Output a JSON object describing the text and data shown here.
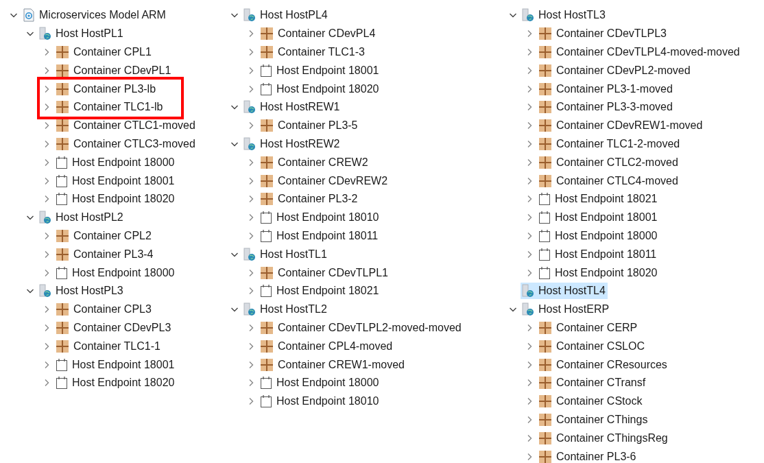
{
  "tree": {
    "kind": "root",
    "label": "Microservices Model ARM",
    "expanded": true,
    "selected": false,
    "children": [
      {
        "kind": "host",
        "label": "Host HostPL1",
        "expanded": true,
        "selected": false,
        "children": [
          {
            "kind": "container",
            "label": "Container CPL1",
            "expanded": false,
            "selected": false,
            "highlighted": false
          },
          {
            "kind": "container",
            "label": "Container CDevPL1",
            "expanded": false,
            "selected": false,
            "highlighted": false
          },
          {
            "kind": "container",
            "label": "Container PL3-lb",
            "expanded": false,
            "selected": false,
            "highlighted": true
          },
          {
            "kind": "container",
            "label": "Container TLC1-lb",
            "expanded": false,
            "selected": false,
            "highlighted": true
          },
          {
            "kind": "container",
            "label": "Container CTLC1-moved",
            "expanded": false,
            "selected": false,
            "highlighted": false
          },
          {
            "kind": "container",
            "label": "Container CTLC3-moved",
            "expanded": false,
            "selected": false,
            "highlighted": false
          },
          {
            "kind": "endpoint",
            "label": "Host Endpoint 18000",
            "expanded": false,
            "selected": false,
            "highlighted": false
          },
          {
            "kind": "endpoint",
            "label": "Host Endpoint 18001",
            "expanded": false,
            "selected": false,
            "highlighted": false
          },
          {
            "kind": "endpoint",
            "label": "Host Endpoint 18020",
            "expanded": false,
            "selected": false,
            "highlighted": false
          }
        ]
      },
      {
        "kind": "host",
        "label": "Host HostPL2",
        "expanded": true,
        "selected": false,
        "children": [
          {
            "kind": "container",
            "label": "Container CPL2",
            "expanded": false,
            "selected": false,
            "highlighted": false
          },
          {
            "kind": "container",
            "label": "Container PL3-4",
            "expanded": false,
            "selected": false,
            "highlighted": false
          },
          {
            "kind": "endpoint",
            "label": "Host Endpoint 18000",
            "expanded": false,
            "selected": false,
            "highlighted": false
          }
        ]
      },
      {
        "kind": "host",
        "label": "Host HostPL3",
        "expanded": true,
        "selected": false,
        "children": [
          {
            "kind": "container",
            "label": "Container CPL3",
            "expanded": false,
            "selected": false,
            "highlighted": false
          },
          {
            "kind": "container",
            "label": "Container CDevPL3",
            "expanded": false,
            "selected": false,
            "highlighted": false
          },
          {
            "kind": "container",
            "label": "Container TLC1-1",
            "expanded": false,
            "selected": false,
            "highlighted": false
          },
          {
            "kind": "endpoint",
            "label": "Host Endpoint 18001",
            "expanded": false,
            "selected": false,
            "highlighted": false
          },
          {
            "kind": "endpoint",
            "label": "Host Endpoint 18020",
            "expanded": false,
            "selected": false,
            "highlighted": false
          }
        ]
      },
      {
        "kind": "host",
        "label": "Host HostPL4",
        "expanded": true,
        "selected": false,
        "children": [
          {
            "kind": "container",
            "label": "Container CDevPL4",
            "expanded": false,
            "selected": false,
            "highlighted": false
          },
          {
            "kind": "container",
            "label": "Container TLC1-3",
            "expanded": false,
            "selected": false,
            "highlighted": false
          },
          {
            "kind": "endpoint",
            "label": "Host Endpoint 18001",
            "expanded": false,
            "selected": false,
            "highlighted": false
          },
          {
            "kind": "endpoint",
            "label": "Host Endpoint 18020",
            "expanded": false,
            "selected": false,
            "highlighted": false
          }
        ]
      },
      {
        "kind": "host",
        "label": "Host HostREW1",
        "expanded": true,
        "selected": false,
        "children": [
          {
            "kind": "container",
            "label": "Container PL3-5",
            "expanded": false,
            "selected": false,
            "highlighted": false
          }
        ]
      },
      {
        "kind": "host",
        "label": "Host HostREW2",
        "expanded": true,
        "selected": false,
        "children": [
          {
            "kind": "container",
            "label": "Container CREW2",
            "expanded": false,
            "selected": false,
            "highlighted": false
          },
          {
            "kind": "container",
            "label": "Container CDevREW2",
            "expanded": false,
            "selected": false,
            "highlighted": false
          },
          {
            "kind": "container",
            "label": "Container PL3-2",
            "expanded": false,
            "selected": false,
            "highlighted": false
          },
          {
            "kind": "endpoint",
            "label": "Host Endpoint 18010",
            "expanded": false,
            "selected": false,
            "highlighted": false
          },
          {
            "kind": "endpoint",
            "label": "Host Endpoint 18011",
            "expanded": false,
            "selected": false,
            "highlighted": false
          }
        ]
      },
      {
        "kind": "host",
        "label": "Host HostTL1",
        "expanded": true,
        "selected": false,
        "children": [
          {
            "kind": "container",
            "label": "Container CDevTLPL1",
            "expanded": false,
            "selected": false,
            "highlighted": false
          },
          {
            "kind": "endpoint",
            "label": "Host Endpoint 18021",
            "expanded": false,
            "selected": false,
            "highlighted": false
          }
        ]
      },
      {
        "kind": "host",
        "label": "Host HostTL2",
        "expanded": true,
        "selected": false,
        "children": [
          {
            "kind": "container",
            "label": "Container CDevTLPL2-moved-moved",
            "expanded": false,
            "selected": false,
            "highlighted": false
          },
          {
            "kind": "container",
            "label": "Container CPL4-moved",
            "expanded": false,
            "selected": false,
            "highlighted": false
          },
          {
            "kind": "container",
            "label": "Container CREW1-moved",
            "expanded": false,
            "selected": false,
            "highlighted": false
          },
          {
            "kind": "endpoint",
            "label": "Host Endpoint 18000",
            "expanded": false,
            "selected": false,
            "highlighted": false
          },
          {
            "kind": "endpoint",
            "label": "Host Endpoint 18010",
            "expanded": false,
            "selected": false,
            "highlighted": false
          }
        ]
      },
      {
        "kind": "host",
        "label": "Host HostTL3",
        "expanded": true,
        "selected": false,
        "children": [
          {
            "kind": "container",
            "label": "Container CDevTLPL3",
            "expanded": false,
            "selected": false,
            "highlighted": false
          },
          {
            "kind": "container",
            "label": "Container CDevTLPL4-moved-moved",
            "expanded": false,
            "selected": false,
            "highlighted": false
          },
          {
            "kind": "container",
            "label": "Container CDevPL2-moved",
            "expanded": false,
            "selected": false,
            "highlighted": false
          },
          {
            "kind": "container",
            "label": "Container PL3-1-moved",
            "expanded": false,
            "selected": false,
            "highlighted": false
          },
          {
            "kind": "container",
            "label": "Container PL3-3-moved",
            "expanded": false,
            "selected": false,
            "highlighted": false
          },
          {
            "kind": "container",
            "label": "Container CDevREW1-moved",
            "expanded": false,
            "selected": false,
            "highlighted": false
          },
          {
            "kind": "container",
            "label": "Container TLC1-2-moved",
            "expanded": false,
            "selected": false,
            "highlighted": false
          },
          {
            "kind": "container",
            "label": "Container CTLC2-moved",
            "expanded": false,
            "selected": false,
            "highlighted": false
          },
          {
            "kind": "container",
            "label": "Container CTLC4-moved",
            "expanded": false,
            "selected": false,
            "highlighted": false
          },
          {
            "kind": "endpoint",
            "label": "Host Endpoint 18021",
            "expanded": false,
            "selected": false,
            "highlighted": false
          },
          {
            "kind": "endpoint",
            "label": "Host Endpoint 18001",
            "expanded": false,
            "selected": false,
            "highlighted": false
          },
          {
            "kind": "endpoint",
            "label": "Host Endpoint 18000",
            "expanded": false,
            "selected": false,
            "highlighted": false
          },
          {
            "kind": "endpoint",
            "label": "Host Endpoint 18011",
            "expanded": false,
            "selected": false,
            "highlighted": false
          },
          {
            "kind": "endpoint",
            "label": "Host Endpoint 18020",
            "expanded": false,
            "selected": false,
            "highlighted": false
          }
        ]
      },
      {
        "kind": "host",
        "label": "Host HostTL4",
        "selected": true
      },
      {
        "kind": "host",
        "label": "Host HostERP",
        "expanded": true,
        "selected": false,
        "children": [
          {
            "kind": "container",
            "label": "Container CERP",
            "expanded": false,
            "selected": false,
            "highlighted": false
          },
          {
            "kind": "container",
            "label": "Container CSLOC",
            "expanded": false,
            "selected": false,
            "highlighted": false
          },
          {
            "kind": "container",
            "label": "Container CResources",
            "expanded": false,
            "selected": false,
            "highlighted": false
          },
          {
            "kind": "container",
            "label": "Container CTransf",
            "expanded": false,
            "selected": false,
            "highlighted": false
          },
          {
            "kind": "container",
            "label": "Container CStock",
            "expanded": false,
            "selected": false,
            "highlighted": false
          },
          {
            "kind": "container",
            "label": "Container CThings",
            "expanded": false,
            "selected": false,
            "highlighted": false
          },
          {
            "kind": "container",
            "label": "Container CThingsReg",
            "expanded": false,
            "selected": false,
            "highlighted": false
          },
          {
            "kind": "container",
            "label": "Container PL3-6",
            "expanded": false,
            "selected": false,
            "highlighted": false
          }
        ]
      }
    ]
  }
}
